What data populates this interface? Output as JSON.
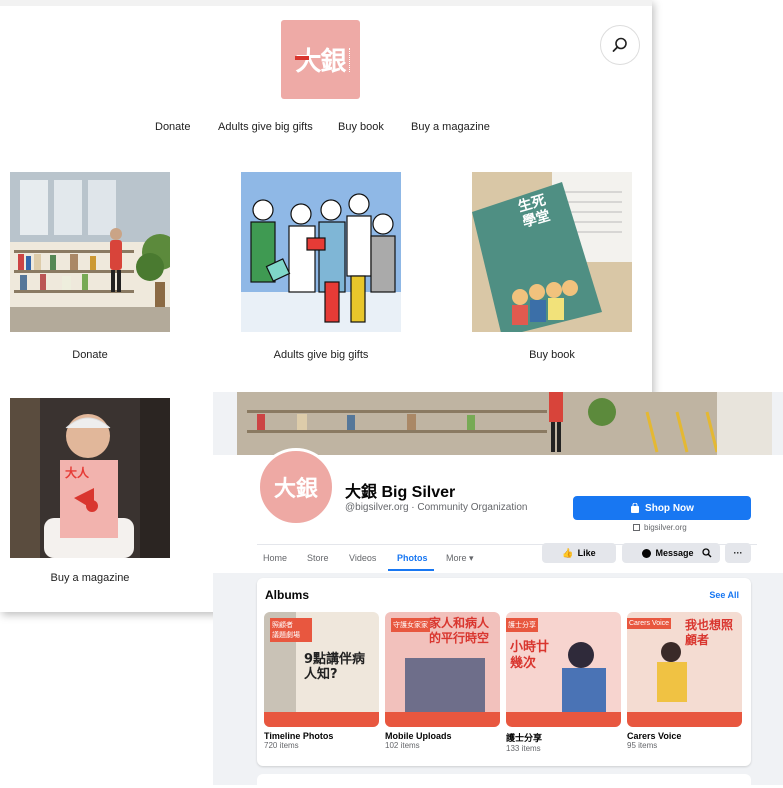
{
  "website": {
    "logo_text": "大銀",
    "nav": [
      "Donate",
      "Adults give big gifts",
      "Buy book",
      "Buy a magazine"
    ],
    "tiles": [
      {
        "caption": "Donate"
      },
      {
        "caption": "Adults give big gifts"
      },
      {
        "caption": "Buy book"
      },
      {
        "caption": "Buy a magazine"
      }
    ],
    "book_cover_text": "生死學堂",
    "magazine_cover_text": "大人",
    "colors": {
      "brand_pink": "#eeaaa6",
      "brand_red": "#d9362f"
    }
  },
  "facebook": {
    "avatar_text": "大銀",
    "page_name": "大銀 Big Silver",
    "handle": "@bigsilver.org · Community Organization",
    "shop_button": "Shop Now",
    "website_link": "bigsilver.org",
    "tabs": [
      "Home",
      "Store",
      "Videos",
      "Photos",
      "More ▾"
    ],
    "active_tab": "Photos",
    "actions": {
      "like": "Like",
      "message": "Message"
    },
    "albums_title": "Albums",
    "see_all": "See All",
    "albums": [
      {
        "name": "Timeline Photos",
        "count": "720 items",
        "tag": "照顧者\n議題劇場",
        "art_text": "9點講伴病人知?"
      },
      {
        "name": "Mobile Uploads",
        "count": "102 items",
        "tag": "守護女家家",
        "art_text": "家人和病人的平行時空"
      },
      {
        "name": "護士分享",
        "count": "133 items",
        "tag": "護士分享",
        "art_text": "小時廿幾次"
      },
      {
        "name": "Carers Voice",
        "count": "95 items",
        "tag": "Carers Voice",
        "art_text": "我也想照顧者"
      }
    ],
    "colors": {
      "primary": "#1877f2",
      "background": "#f0f2f5"
    }
  }
}
